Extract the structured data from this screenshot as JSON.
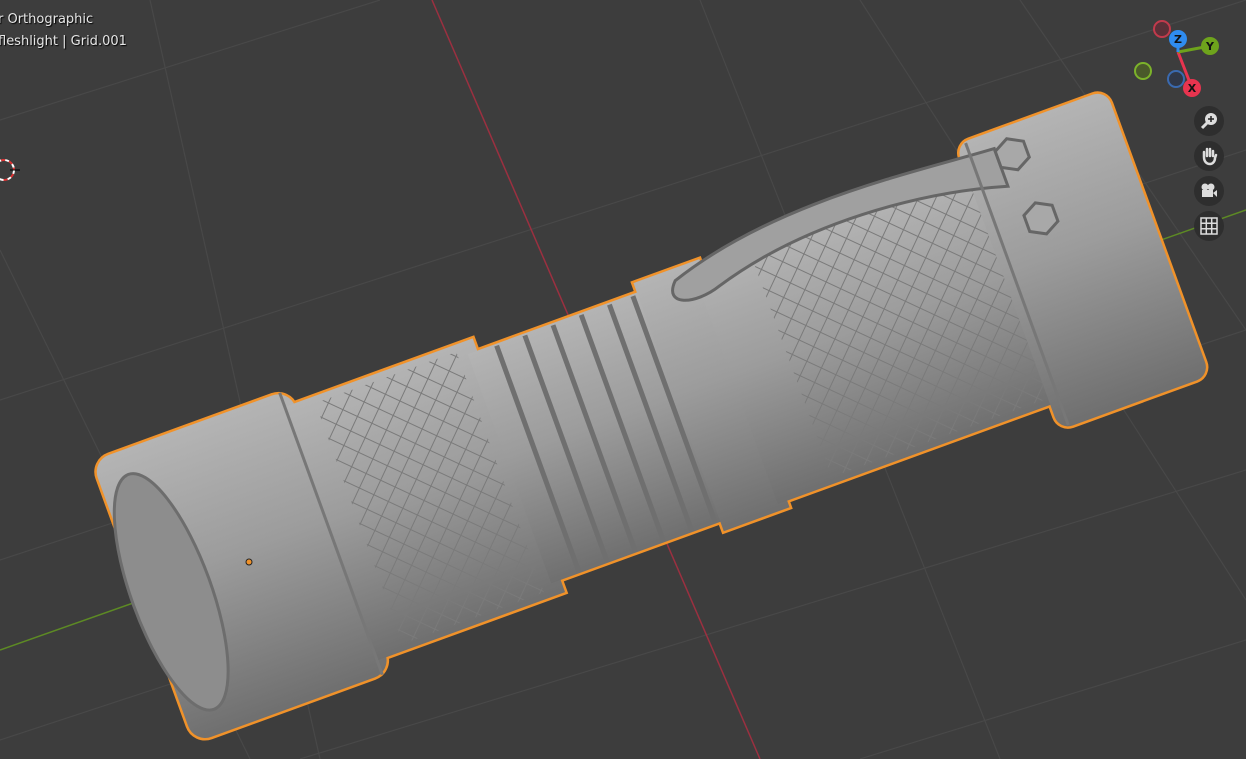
{
  "viewport": {
    "view_name": "r Orthographic",
    "object_info": "fleshlight | Grid.001"
  },
  "gizmo": {
    "x_label": "X",
    "y_label": "Y",
    "z_label": "Z",
    "x_color": "#e8344f",
    "y_color": "#6ea31c",
    "z_color": "#2f8cf0"
  },
  "nav_buttons": [
    {
      "name": "zoom",
      "icon": "zoom-in-icon"
    },
    {
      "name": "pan",
      "icon": "hand-icon"
    },
    {
      "name": "camera",
      "icon": "camera-icon"
    },
    {
      "name": "ortho",
      "icon": "grid-icon"
    }
  ],
  "colors": {
    "background": "#3d3d3d",
    "selection_outline": "#f0922a",
    "mesh": "#9a9a9a"
  }
}
